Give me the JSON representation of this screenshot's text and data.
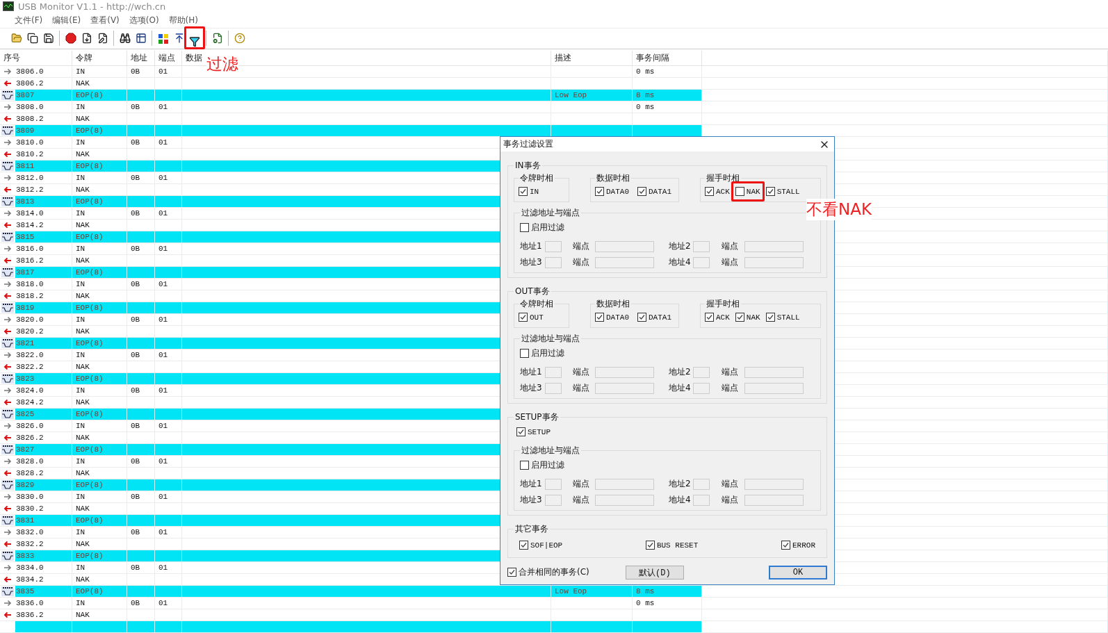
{
  "window": {
    "title": "USB Monitor V1.1 - http://wch.cn"
  },
  "menu": [
    "文件(F)",
    "编辑(E)",
    "查看(V)",
    "选项(O)",
    "帮助(H)"
  ],
  "toolbar": [
    {
      "kind": "open",
      "highlighted": false
    },
    {
      "kind": "copy",
      "highlighted": false
    },
    {
      "kind": "save",
      "highlighted": false
    },
    {
      "kind": "separator",
      "highlighted": false
    },
    {
      "kind": "stop",
      "highlighted": false
    },
    {
      "kind": "export",
      "highlighted": false
    },
    {
      "kind": "edit",
      "highlighted": false
    },
    {
      "kind": "separator",
      "highlighted": false
    },
    {
      "kind": "find",
      "highlighted": false
    },
    {
      "kind": "table",
      "highlighted": false
    },
    {
      "kind": "separator",
      "highlighted": false
    },
    {
      "kind": "colors",
      "highlighted": false
    },
    {
      "kind": "up",
      "highlighted": false
    },
    {
      "kind": "filter",
      "highlighted": true
    },
    {
      "kind": "separator",
      "highlighted": false
    },
    {
      "kind": "settings",
      "highlighted": false
    },
    {
      "kind": "separator",
      "highlighted": false
    },
    {
      "kind": "help",
      "highlighted": false
    }
  ],
  "table": {
    "columns": [
      "序号",
      "令牌",
      "地址",
      "端点",
      "数据",
      "描述",
      "事务间隔"
    ],
    "rows": [
      {
        "kind": "in",
        "seq": "3806.0",
        "token": "IN",
        "addr": "0B",
        "ep": "01",
        "interval": "0 ms"
      },
      {
        "kind": "nak",
        "seq": "3806.2",
        "token": "NAK"
      },
      {
        "kind": "sof",
        "seq": "3807",
        "token": "EOP(8)",
        "desc": "Low Eop",
        "interval": "8 ms"
      },
      {
        "kind": "in",
        "seq": "3808.0",
        "token": "IN",
        "addr": "0B",
        "ep": "01",
        "interval": "0 ms"
      },
      {
        "kind": "nak",
        "seq": "3808.2",
        "token": "NAK"
      },
      {
        "kind": "sof",
        "seq": "3809",
        "token": "EOP(8)"
      },
      {
        "kind": "in",
        "seq": "3810.0",
        "token": "IN",
        "addr": "0B",
        "ep": "01"
      },
      {
        "kind": "nak",
        "seq": "3810.2",
        "token": "NAK"
      },
      {
        "kind": "sof",
        "seq": "3811",
        "token": "EOP(8)"
      },
      {
        "kind": "in",
        "seq": "3812.0",
        "token": "IN",
        "addr": "0B",
        "ep": "01"
      },
      {
        "kind": "nak",
        "seq": "3812.2",
        "token": "NAK"
      },
      {
        "kind": "sof",
        "seq": "3813",
        "token": "EOP(8)"
      },
      {
        "kind": "in",
        "seq": "3814.0",
        "token": "IN",
        "addr": "0B",
        "ep": "01"
      },
      {
        "kind": "nak",
        "seq": "3814.2",
        "token": "NAK"
      },
      {
        "kind": "sof",
        "seq": "3815",
        "token": "EOP(8)"
      },
      {
        "kind": "in",
        "seq": "3816.0",
        "token": "IN",
        "addr": "0B",
        "ep": "01"
      },
      {
        "kind": "nak",
        "seq": "3816.2",
        "token": "NAK"
      },
      {
        "kind": "sof",
        "seq": "3817",
        "token": "EOP(8)"
      },
      {
        "kind": "in",
        "seq": "3818.0",
        "token": "IN",
        "addr": "0B",
        "ep": "01"
      },
      {
        "kind": "nak",
        "seq": "3818.2",
        "token": "NAK"
      },
      {
        "kind": "sof",
        "seq": "3819",
        "token": "EOP(8)"
      },
      {
        "kind": "in",
        "seq": "3820.0",
        "token": "IN",
        "addr": "0B",
        "ep": "01"
      },
      {
        "kind": "nak",
        "seq": "3820.2",
        "token": "NAK"
      },
      {
        "kind": "sof",
        "seq": "3821",
        "token": "EOP(8)"
      },
      {
        "kind": "in",
        "seq": "3822.0",
        "token": "IN",
        "addr": "0B",
        "ep": "01"
      },
      {
        "kind": "nak",
        "seq": "3822.2",
        "token": "NAK"
      },
      {
        "kind": "sof",
        "seq": "3823",
        "token": "EOP(8)"
      },
      {
        "kind": "in",
        "seq": "3824.0",
        "token": "IN",
        "addr": "0B",
        "ep": "01"
      },
      {
        "kind": "nak",
        "seq": "3824.2",
        "token": "NAK"
      },
      {
        "kind": "sof",
        "seq": "3825",
        "token": "EOP(8)"
      },
      {
        "kind": "in",
        "seq": "3826.0",
        "token": "IN",
        "addr": "0B",
        "ep": "01"
      },
      {
        "kind": "nak",
        "seq": "3826.2",
        "token": "NAK"
      },
      {
        "kind": "sof",
        "seq": "3827",
        "token": "EOP(8)"
      },
      {
        "kind": "in",
        "seq": "3828.0",
        "token": "IN",
        "addr": "0B",
        "ep": "01"
      },
      {
        "kind": "nak",
        "seq": "3828.2",
        "token": "NAK"
      },
      {
        "kind": "sof",
        "seq": "3829",
        "token": "EOP(8)"
      },
      {
        "kind": "in",
        "seq": "3830.0",
        "token": "IN",
        "addr": "0B",
        "ep": "01"
      },
      {
        "kind": "nak",
        "seq": "3830.2",
        "token": "NAK"
      },
      {
        "kind": "sof",
        "seq": "3831",
        "token": "EOP(8)"
      },
      {
        "kind": "in",
        "seq": "3832.0",
        "token": "IN",
        "addr": "0B",
        "ep": "01"
      },
      {
        "kind": "nak",
        "seq": "3832.2",
        "token": "NAK"
      },
      {
        "kind": "sof",
        "seq": "3833",
        "token": "EOP(8)"
      },
      {
        "kind": "in",
        "seq": "3834.0",
        "token": "IN",
        "addr": "0B",
        "ep": "01"
      },
      {
        "kind": "nak",
        "seq": "3834.2",
        "token": "NAK"
      },
      {
        "kind": "sof",
        "seq": "3835",
        "token": "EOP(8)",
        "desc": "Low Eop",
        "interval": "8 ms"
      },
      {
        "kind": "in",
        "seq": "3836.0",
        "token": "IN",
        "addr": "0B",
        "ep": "01",
        "interval": "0 ms"
      },
      {
        "kind": "nak",
        "seq": "3836.2",
        "token": "NAK"
      },
      {
        "kind": "sof"
      }
    ]
  },
  "dialog": {
    "title": "事务过滤设置",
    "groups": [
      {
        "kind": "transfer",
        "title": "IN事务",
        "phases": [
          {
            "title": "令牌时相",
            "options": [
              {
                "label": "IN",
                "checked": true,
                "highlighted": false
              }
            ]
          },
          {
            "title": "数据时相",
            "options": [
              {
                "label": "DATA0",
                "checked": true,
                "highlighted": false
              },
              {
                "label": "DATA1",
                "checked": true,
                "highlighted": false
              }
            ]
          },
          {
            "title": "握手时相",
            "options": [
              {
                "label": "ACK",
                "checked": true,
                "highlighted": false
              },
              {
                "label": "NAK",
                "checked": false,
                "highlighted": true
              },
              {
                "label": "STALL",
                "checked": true,
                "highlighted": false
              }
            ]
          }
        ],
        "filter": {
          "title": "过滤地址与端点",
          "enable": {
            "label": "启用过滤",
            "checked": false
          },
          "fields": [
            {
              "addr": "地址1",
              "ep": "端点"
            },
            {
              "addr": "地址2",
              "ep": "端点"
            },
            {
              "addr": "地址3",
              "ep": "端点"
            },
            {
              "addr": "地址4",
              "ep": "端点"
            }
          ]
        }
      },
      {
        "kind": "transfer",
        "title": "OUT事务",
        "phases": [
          {
            "title": "令牌时相",
            "options": [
              {
                "label": "OUT",
                "checked": true,
                "highlighted": false
              }
            ]
          },
          {
            "title": "数据时相",
            "options": [
              {
                "label": "DATA0",
                "checked": true,
                "highlighted": false
              },
              {
                "label": "DATA1",
                "checked": true,
                "highlighted": false
              }
            ]
          },
          {
            "title": "握手时相",
            "options": [
              {
                "label": "ACK",
                "checked": true,
                "highlighted": false
              },
              {
                "label": "NAK",
                "checked": true,
                "highlighted": false
              },
              {
                "label": "STALL",
                "checked": true,
                "highlighted": false
              }
            ]
          }
        ],
        "filter": {
          "title": "过滤地址与端点",
          "enable": {
            "label": "启用过滤",
            "checked": false
          },
          "fields": [
            {
              "addr": "地址1",
              "ep": "端点"
            },
            {
              "addr": "地址2",
              "ep": "端点"
            },
            {
              "addr": "地址3",
              "ep": "端点"
            },
            {
              "addr": "地址4",
              "ep": "端点"
            }
          ]
        }
      },
      {
        "kind": "setup",
        "title": "SETUP事务",
        "options": [
          {
            "label": "SETUP",
            "checked": true,
            "highlighted": false
          }
        ],
        "filter": {
          "title": "过滤地址与端点",
          "enable": {
            "label": "启用过滤",
            "checked": false
          },
          "fields": [
            {
              "addr": "地址1",
              "ep": "端点"
            },
            {
              "addr": "地址2",
              "ep": "端点"
            },
            {
              "addr": "地址3",
              "ep": "端点"
            },
            {
              "addr": "地址4",
              "ep": "端点"
            }
          ]
        }
      },
      {
        "kind": "other",
        "title": "其它事务",
        "options": [
          {
            "label": "SOF|EOP",
            "checked": true,
            "highlighted": false
          },
          {
            "label": "BUS RESET",
            "checked": true,
            "highlighted": false
          },
          {
            "label": "ERROR",
            "checked": true,
            "highlighted": false
          }
        ]
      }
    ],
    "merge": {
      "label": "合并相同的事务(C)",
      "checked": true
    },
    "buttons": [
      {
        "label": "默认(D)",
        "default": false
      },
      {
        "label": "OK",
        "default": true
      }
    ]
  },
  "annotations": [
    {
      "text": "过滤"
    },
    {
      "text": "不看NAK"
    }
  ]
}
